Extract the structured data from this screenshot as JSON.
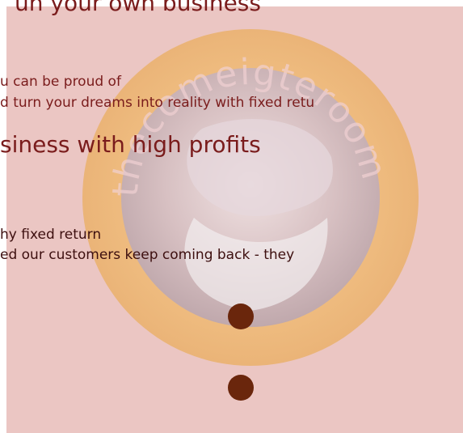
{
  "section1": {
    "heading": "un your own business",
    "line1": "u can be proud of",
    "line2": "d turn your dreams into reality with fixed retu"
  },
  "section2": {
    "heading": "siness with high profits",
    "line1": "hy fixed return",
    "line2": "ed our customers keep coming back - they"
  },
  "watermark": {
    "text": "thecomeigteroom",
    "ring_color": "#f3b64a",
    "inner_color": "#d9c3c8"
  },
  "colors": {
    "panel": "#ebc6c3",
    "heading": "#7a1c1c",
    "dark_text": "#3d0f0f",
    "dot": "#6a260c"
  }
}
